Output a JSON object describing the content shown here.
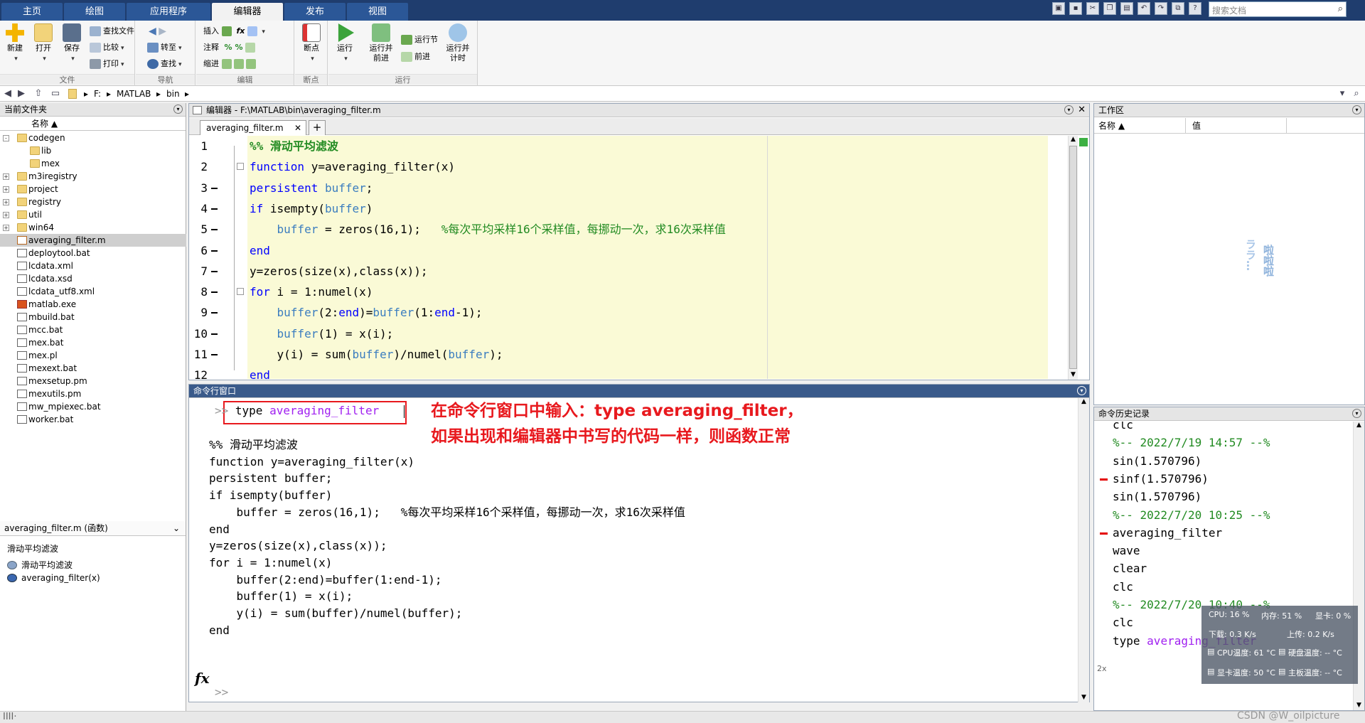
{
  "tabs": [
    "主页",
    "绘图",
    "应用程序",
    "编辑器",
    "发布",
    "视图"
  ],
  "search_placeholder": "搜索文档",
  "ribbon": {
    "file": {
      "label": "文件",
      "new": "新建",
      "open": "打开",
      "save": "保存",
      "find_files": "查找文件",
      "compare": "比较",
      "print": "打印"
    },
    "nav": {
      "label": "导航",
      "goto": "转至",
      "find": "查找"
    },
    "edit": {
      "label": "编辑",
      "insert": "插入",
      "comment": "注释",
      "indent": "缩进"
    },
    "breakpoints": {
      "label": "断点",
      "btn": "断点"
    },
    "run": {
      "label": "运行",
      "run": "运行",
      "run_advance": "运行并\n前进",
      "run_section": "运行节",
      "advance": "前进",
      "run_time": "运行并\n计时"
    }
  },
  "address": {
    "segments": [
      "F:",
      "MATLAB",
      "bin"
    ]
  },
  "current_folder": {
    "title": "当前文件夹",
    "col_name": "名称 ▲",
    "items": [
      {
        "name": "codegen",
        "type": "folder",
        "expand": "-"
      },
      {
        "name": "lib",
        "type": "folder",
        "expand": ""
      },
      {
        "name": "mex",
        "type": "folder",
        "expand": ""
      },
      {
        "name": "m3iregistry",
        "type": "folder",
        "expand": "+"
      },
      {
        "name": "project",
        "type": "folder",
        "expand": "+"
      },
      {
        "name": "registry",
        "type": "folder",
        "expand": "+"
      },
      {
        "name": "util",
        "type": "folder",
        "expand": "+"
      },
      {
        "name": "win64",
        "type": "folder",
        "expand": "+"
      },
      {
        "name": "averaging_filter.m",
        "type": "mfile",
        "expand": ""
      },
      {
        "name": "deploytool.bat",
        "type": "file",
        "expand": ""
      },
      {
        "name": "lcdata.xml",
        "type": "file",
        "expand": ""
      },
      {
        "name": "lcdata.xsd",
        "type": "file",
        "expand": ""
      },
      {
        "name": "lcdata_utf8.xml",
        "type": "file",
        "expand": ""
      },
      {
        "name": "matlab.exe",
        "type": "exe",
        "expand": ""
      },
      {
        "name": "mbuild.bat",
        "type": "file",
        "expand": ""
      },
      {
        "name": "mcc.bat",
        "type": "file",
        "expand": ""
      },
      {
        "name": "mex.bat",
        "type": "file",
        "expand": ""
      },
      {
        "name": "mex.pl",
        "type": "file",
        "expand": ""
      },
      {
        "name": "mexext.bat",
        "type": "file",
        "expand": ""
      },
      {
        "name": "mexsetup.pm",
        "type": "file",
        "expand": ""
      },
      {
        "name": "mexutils.pm",
        "type": "file",
        "expand": ""
      },
      {
        "name": "mw_mpiexec.bat",
        "type": "file",
        "expand": ""
      },
      {
        "name": "worker.bat",
        "type": "file",
        "expand": ""
      }
    ],
    "details_title": "averaging_filter.m  (函数)",
    "details_desc": "滑动平均滤波",
    "details_items": [
      "滑动平均滤波",
      "averaging_filter(x)"
    ]
  },
  "editor": {
    "title": "编辑器 - F:\\MATLAB\\bin\\averaging_filter.m",
    "tab": "averaging_filter.m",
    "add_tab": "+",
    "line_numbers": [
      "1",
      "2",
      "3",
      "4",
      "5",
      "6",
      "7",
      "8",
      "9",
      "10",
      "11",
      "12"
    ]
  },
  "command_window": {
    "title": "命令行窗口",
    "prompt": ">>",
    "input_cmd": "type",
    "input_arg": "averaging_filter",
    "output": [
      "%% 滑动平均滤波",
      "function y=averaging_filter(x)",
      "persistent buffer;",
      "if isempty(buffer)",
      "    buffer = zeros(16,1);   %每次平均采样16个采样值，每挪动一次，求16次采样值",
      "end",
      "y=zeros(size(x),class(x));",
      "for i = 1:numel(x)",
      "    buffer(2:end)=buffer(1:end-1);",
      "    buffer(1) = x(i);",
      "    y(i) = sum(buffer)/numel(buffer);",
      "end"
    ],
    "annotation_line1": "在命令行窗口中输入：type averaging_filter，",
    "annotation_line2": "如果出现和编辑器中书写的代码一样，则函数正常",
    "fx": "fx"
  },
  "workspace": {
    "title": "工作区",
    "col_name": "名称 ▲",
    "col_value": "值",
    "watermark_a": "ララ…",
    "watermark_b": "啦啦啦"
  },
  "history": {
    "title": "命令历史记录",
    "lines": [
      {
        "text": "clc",
        "style": "cmd",
        "mark": false
      },
      {
        "text": "%-- 2022/7/19 14:57 --%",
        "style": "sep",
        "mark": false
      },
      {
        "text": "sin(1.570796)",
        "style": "cmd",
        "mark": false
      },
      {
        "text": "sinf(1.570796)",
        "style": "cmd",
        "mark": true
      },
      {
        "text": "sin(1.570796)",
        "style": "cmd",
        "mark": false
      },
      {
        "text": "%-- 2022/7/20 10:25 --%",
        "style": "sep",
        "mark": false
      },
      {
        "text": "averaging_filter",
        "style": "cmd",
        "mark": true
      },
      {
        "text": "wave",
        "style": "cmd",
        "mark": false
      },
      {
        "text": "clear",
        "style": "cmd",
        "mark": false
      },
      {
        "text": "clc",
        "style": "cmd",
        "mark": false
      },
      {
        "text": "%-- 2022/7/20 10:40 --%",
        "style": "sep",
        "mark": false
      },
      {
        "text": "clc",
        "style": "cmd",
        "mark": false
      },
      {
        "text": "type averaging_filter",
        "style": "cmd",
        "mark": false
      }
    ],
    "repeat_badge": "2x"
  },
  "sysmon": {
    "cpu": "CPU: 16 %",
    "mem": "内存: 51 %",
    "gpu": "显卡: 0 %",
    "down": "下载: 0.3 K/s",
    "up": "上传: 0.2 K/s",
    "cpu_temp": "CPU温度: 61 °C",
    "disk_temp": "硬盘温度: -- °C",
    "gpu_temp": "显卡温度: 50 °C",
    "board_temp": "主板温度: -- °C"
  },
  "watermark": "CSDN @W_oilpicture",
  "status_text": "IIII·"
}
